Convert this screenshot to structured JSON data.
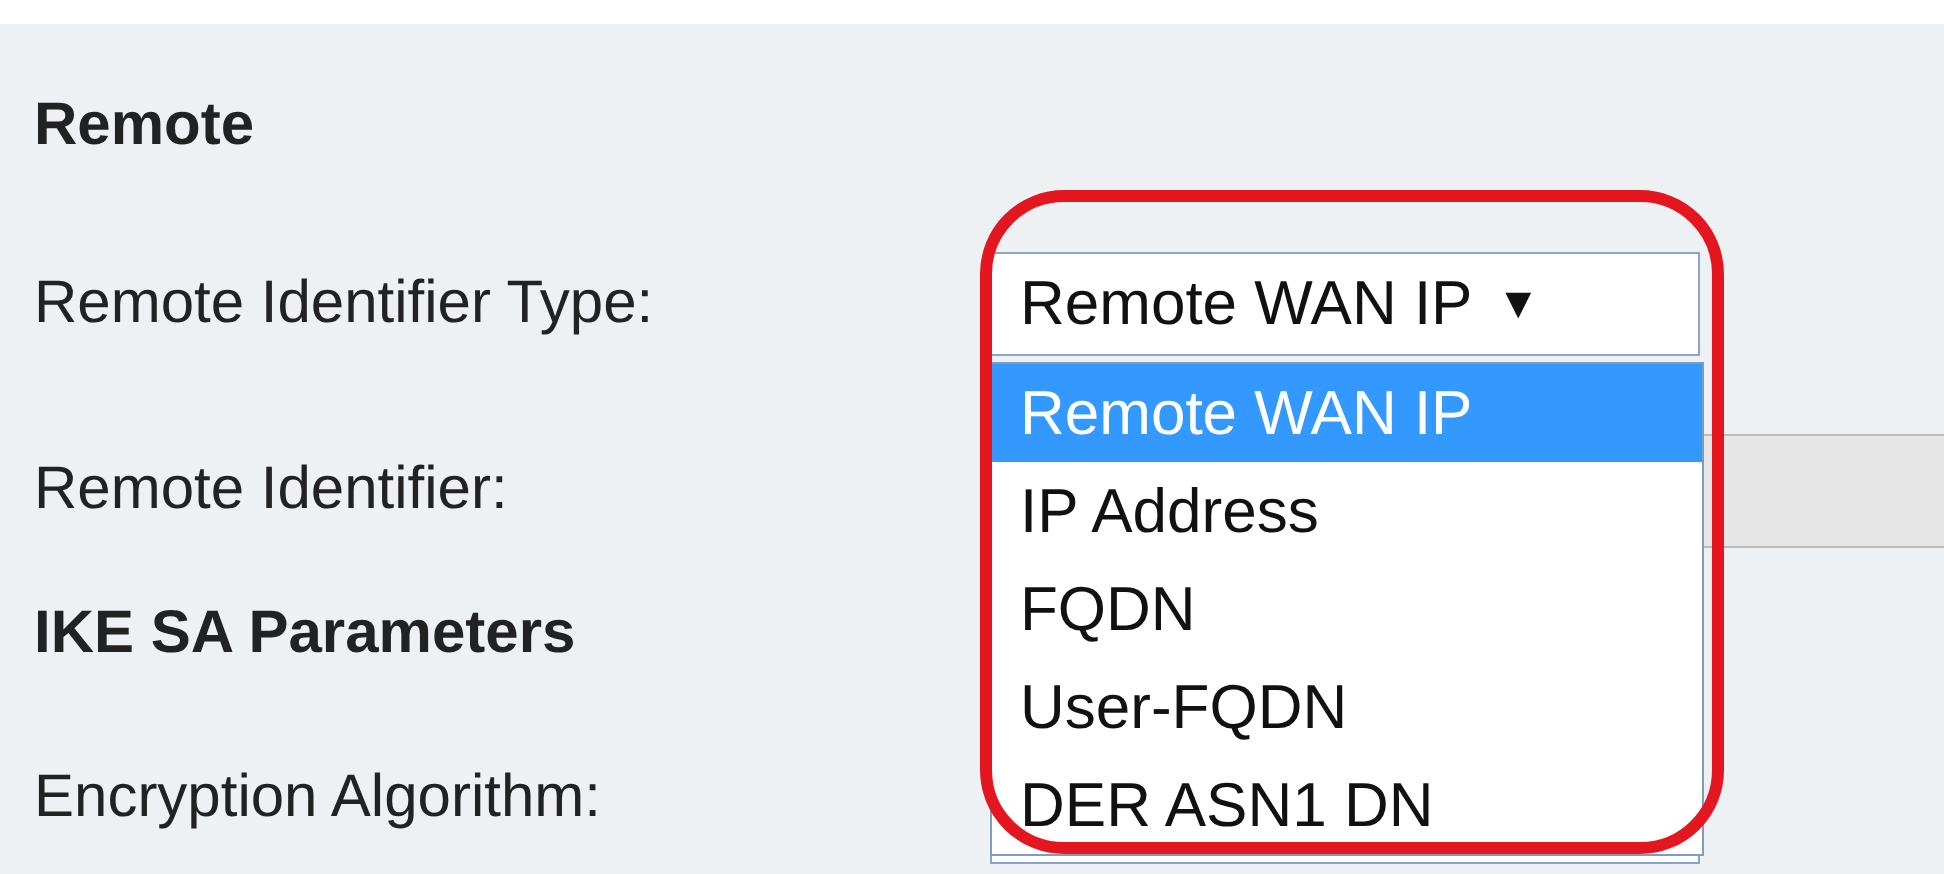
{
  "sections": [
    {
      "title": "Remote",
      "fields": [
        {
          "label": "Remote Identifier Type:",
          "kind": "select",
          "value": "Remote WAN IP",
          "caret": "▼",
          "expanded": true,
          "options": [
            {
              "label": "Remote WAN IP",
              "selected": true
            },
            {
              "label": "IP Address",
              "selected": false
            },
            {
              "label": "FQDN",
              "selected": false
            },
            {
              "label": "User-FQDN",
              "selected": false
            },
            {
              "label": "DER ASN1 DN",
              "selected": false
            }
          ]
        },
        {
          "label": "Remote Identifier:",
          "kind": "text"
        }
      ]
    },
    {
      "title": "IKE SA Parameters",
      "fields": [
        {
          "label": "Encryption Algorithm:",
          "kind": "select",
          "expanded": false
        }
      ]
    }
  ]
}
